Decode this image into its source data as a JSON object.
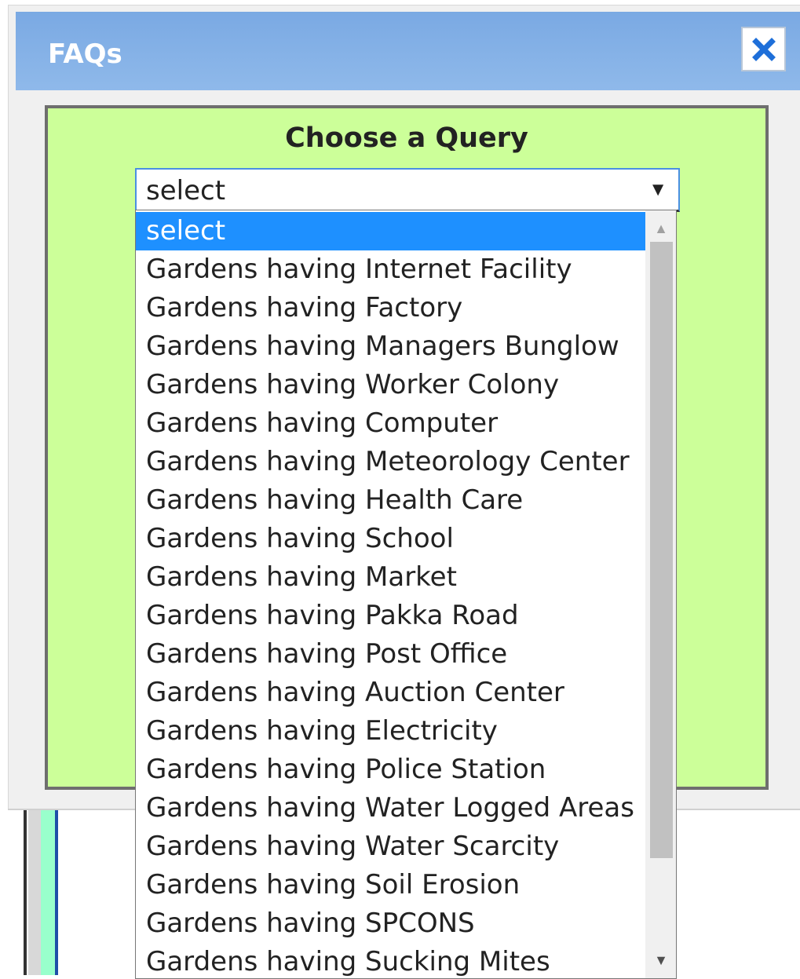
{
  "dialog": {
    "title": "FAQs",
    "close_icon": "close-x-icon"
  },
  "panel": {
    "heading": "Choose a Query",
    "select": {
      "value": "select",
      "arrow": "▼"
    },
    "options": [
      "select",
      "Gardens having Internet Facility",
      "Gardens having Factory",
      "Gardens having Managers Bunglow",
      "Gardens having Worker Colony",
      "Gardens having Computer",
      "Gardens having Meteorology Center",
      "Gardens having Health Care",
      "Gardens having School",
      "Gardens having Market",
      "Gardens having Pakka Road",
      "Gardens having Post Office",
      "Gardens having Auction Center",
      "Gardens having Electricity",
      "Gardens having Police Station",
      "Gardens having Water Logged Areas",
      "Gardens having Water Scarcity",
      "Gardens having Soil Erosion",
      "Gardens having SPCONS",
      "Gardens having Sucking Mites"
    ],
    "selected_index": 0
  },
  "colors": {
    "titlebar": "#7aa9e3",
    "panel_bg": "#ccff99",
    "selected_option": "#1e90ff",
    "close_icon": "#1e6fd9"
  }
}
